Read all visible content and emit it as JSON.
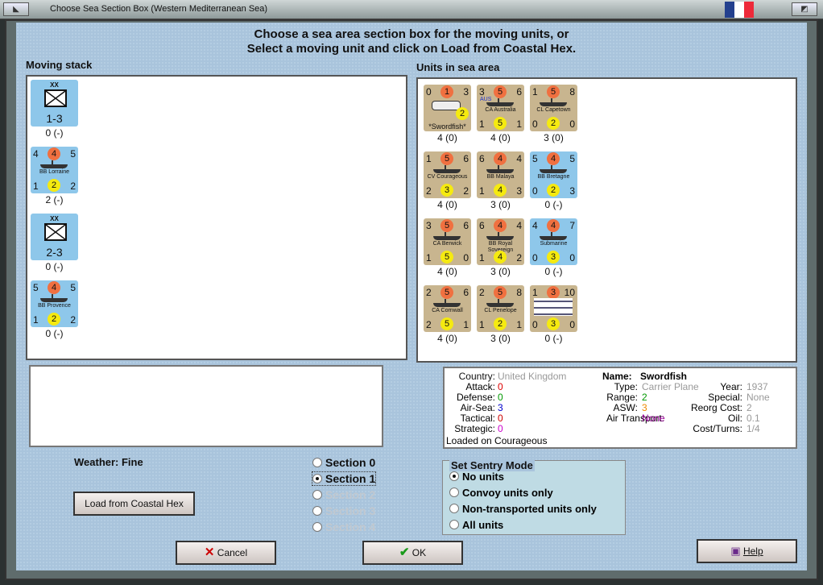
{
  "window": {
    "title": "Choose Sea Section Box (Western Mediterranean Sea)"
  },
  "header": {
    "line1": "Choose a sea area section box for the moving units, or",
    "line2": "Select a moving unit and click on Load from Coastal Hex."
  },
  "moving_stack": {
    "label": "Moving stack",
    "units": [
      {
        "type": "air",
        "top": "XX",
        "main": "1-3",
        "cap": "0 (-)"
      },
      {
        "type": "ship",
        "tl": "4",
        "red": "4",
        "tr": "5",
        "name": "BB Lorraine",
        "bl": "1",
        "yel": "2",
        "br": "2",
        "cap": "2 (-)"
      },
      {
        "type": "air2",
        "top": "XX",
        "main": "2-3",
        "cap": "0 (-)"
      },
      {
        "type": "ship",
        "tl": "5",
        "red": "4",
        "tr": "5",
        "name": "BB Provence",
        "bl": "1",
        "yel": "2",
        "br": "2",
        "cap": "0 (-)"
      }
    ]
  },
  "sea_area": {
    "label": "Units in sea area",
    "units": [
      {
        "color": "tan",
        "tl": "0",
        "red": "1",
        "tr": "3",
        "name": "*Swordfish*",
        "bl": "",
        "yel": "2",
        "br": "",
        "cap": "4 (0)",
        "plane": true
      },
      {
        "color": "tan",
        "tl": "3",
        "red": "5",
        "tr": "6",
        "name": "CA Australia",
        "bl": "1",
        "yel": "5",
        "br": "1",
        "cap": "4 (0)",
        "flag": "AUS"
      },
      {
        "color": "tan",
        "tl": "1",
        "red": "5",
        "tr": "8",
        "name": "CL Capetown",
        "bl": "0",
        "yel": "2",
        "br": "0",
        "cap": "3 (0)"
      },
      {
        "color": "tan",
        "tl": "1",
        "red": "5",
        "tr": "6",
        "name": "CV Courageous",
        "bl": "2",
        "yel": "3",
        "br": "2",
        "cap": "4 (0)"
      },
      {
        "color": "tan",
        "tl": "6",
        "red": "4",
        "tr": "4",
        "name": "BB Malaya",
        "bl": "1",
        "yel": "4",
        "br": "3",
        "cap": "3 (0)"
      },
      {
        "color": "blue",
        "tl": "5",
        "red": "4",
        "tr": "5",
        "name": "BB Bretagne",
        "bl": "0",
        "yel": "2",
        "br": "3",
        "cap": "0 (-)"
      },
      {
        "color": "tan",
        "tl": "3",
        "red": "5",
        "tr": "6",
        "name": "CA Berwick",
        "bl": "1",
        "yel": "5",
        "br": "0",
        "cap": "4 (0)"
      },
      {
        "color": "tan",
        "tl": "6",
        "red": "4",
        "tr": "4",
        "name": "BB Royal Sovereign",
        "bl": "1",
        "yel": "4",
        "br": "2",
        "cap": "3 (0)"
      },
      {
        "color": "blue",
        "tl": "4",
        "red": "4",
        "tr": "7",
        "name": "Submarine",
        "bl": "0",
        "yel": "3",
        "br": "0",
        "cap": "0 (-)"
      },
      {
        "color": "tan",
        "tl": "2",
        "red": "5",
        "tr": "6",
        "name": "CA Cornwall",
        "bl": "2",
        "yel": "5",
        "br": "1",
        "cap": "4 (0)"
      },
      {
        "color": "tan",
        "tl": "2",
        "red": "5",
        "tr": "8",
        "name": "CL Penelope",
        "bl": "1",
        "yel": "2",
        "br": "1",
        "cap": "3 (0)"
      },
      {
        "color": "tan",
        "tl": "1",
        "red": "3",
        "tr": "10",
        "name": "",
        "bl": "0",
        "yel": "3",
        "br": "0",
        "cap": "0 (-)"
      }
    ]
  },
  "weather": "Weather: Fine",
  "load_button": "Load from Coastal Hex",
  "sections": [
    "Section 0",
    "Section 1",
    "Section 2",
    "Section 3",
    "Section 4"
  ],
  "info": {
    "country_k": "Country:",
    "country_v": "United Kingdom",
    "attack_k": "Attack:",
    "attack_v": "0",
    "defense_k": "Defense:",
    "defense_v": "0",
    "airsea_k": "Air-Sea:",
    "airsea_v": "3",
    "tactical_k": "Tactical:",
    "tactical_v": "0",
    "strategic_k": "Strategic:",
    "strategic_v": "0",
    "loaded": "Loaded on Courageous",
    "name_k": "Name:",
    "name_v": "Swordfish",
    "type_k": "Type:",
    "type_v": "Carrier Plane",
    "range_k": "Range:",
    "range_v": "2",
    "asw_k": "ASW:",
    "asw_v": "3",
    "airtr_k": "Air Transport:",
    "airtr_v": "None",
    "year_k": "Year:",
    "year_v": "1937",
    "special_k": "Special:",
    "special_v": "None",
    "reorg_k": "Reorg Cost:",
    "reorg_v": "2",
    "oil_k": "Oil:",
    "oil_v": "0.1",
    "cost_k": "Cost/Turns:",
    "cost_v": "1/4"
  },
  "sentry": {
    "title": "Set Sentry Mode",
    "options": [
      "No units",
      "Convoy units only",
      "Non-transported units only",
      "All units"
    ]
  },
  "buttons": {
    "cancel": "Cancel",
    "ok": "OK",
    "help": "Help"
  }
}
